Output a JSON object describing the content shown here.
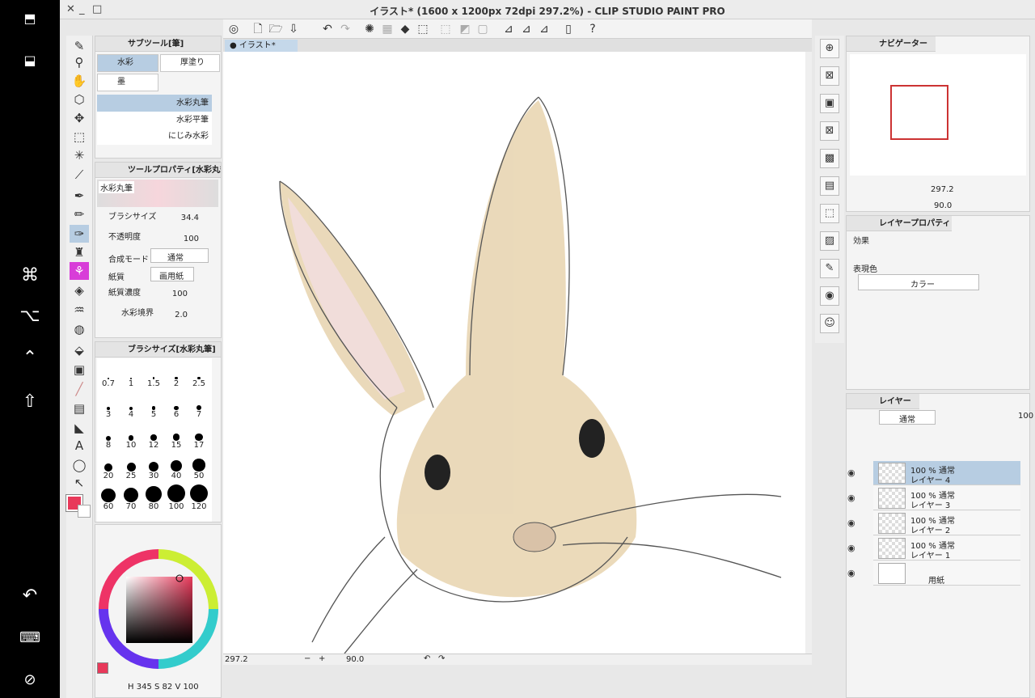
{
  "window": {
    "title": "イラスト* (1600 x 1200px 72dpi 297.2%)  - CLIP STUDIO PAINT PRO",
    "close": "✕",
    "minimize": "_",
    "maximize": "□"
  },
  "canvas_tab": {
    "label": "● イラスト*"
  },
  "subtool": {
    "header": "サブツール[筆]",
    "groups": [
      "水彩",
      "厚塗り",
      "墨"
    ],
    "brushes": [
      "水彩丸筆",
      "水彩平筆",
      "にじみ水彩"
    ]
  },
  "tool_property": {
    "header": "ツールプロパティ[水彩丸筆]",
    "preview_label": "水彩丸筆",
    "rows": [
      {
        "label": "ブラシサイズ",
        "value": "34.4"
      },
      {
        "label": "不透明度",
        "value": "100"
      },
      {
        "label": "合成モード",
        "value": "通常"
      },
      {
        "label": "紙質",
        "value": "画用紙"
      },
      {
        "label": "紙質濃度",
        "value": "100"
      },
      {
        "label": "水彩境界",
        "value": "2.0"
      }
    ]
  },
  "brush_size": {
    "header": "ブラシサイズ[水彩丸筆]",
    "sizes": [
      "0.7",
      "1",
      "1.5",
      "2",
      "2.5",
      "3",
      "4",
      "5",
      "6",
      "7",
      "8",
      "10",
      "12",
      "15",
      "17",
      "20",
      "25",
      "30",
      "40",
      "50",
      "60",
      "70",
      "80",
      "100",
      "120"
    ]
  },
  "color": {
    "main": "#e8395a",
    "hsv": {
      "h_label": "H",
      "h": "345",
      "s_label": "S",
      "s": "82",
      "v_label": "V",
      "v": "100"
    }
  },
  "navigator": {
    "header": "ナビゲーター",
    "zoom": "297.2",
    "angle": "90.0"
  },
  "layer_property": {
    "header": "レイヤープロパティ",
    "effect_label": "効果",
    "expression_label": "表現色",
    "expression_value": "カラー"
  },
  "layers": {
    "header": "レイヤー",
    "blend": "通常",
    "opacity": "100",
    "items": [
      {
        "mode": "100 % 通常",
        "name": "レイヤー 4"
      },
      {
        "mode": "100 % 通常",
        "name": "レイヤー 3"
      },
      {
        "mode": "100 % 通常",
        "name": "レイヤー 2"
      },
      {
        "mode": "100 % 通常",
        "name": "レイヤー 1"
      },
      {
        "mode": "",
        "name": "用紙"
      }
    ]
  },
  "status": {
    "zoom": "297.2",
    "angle": "90.0"
  }
}
